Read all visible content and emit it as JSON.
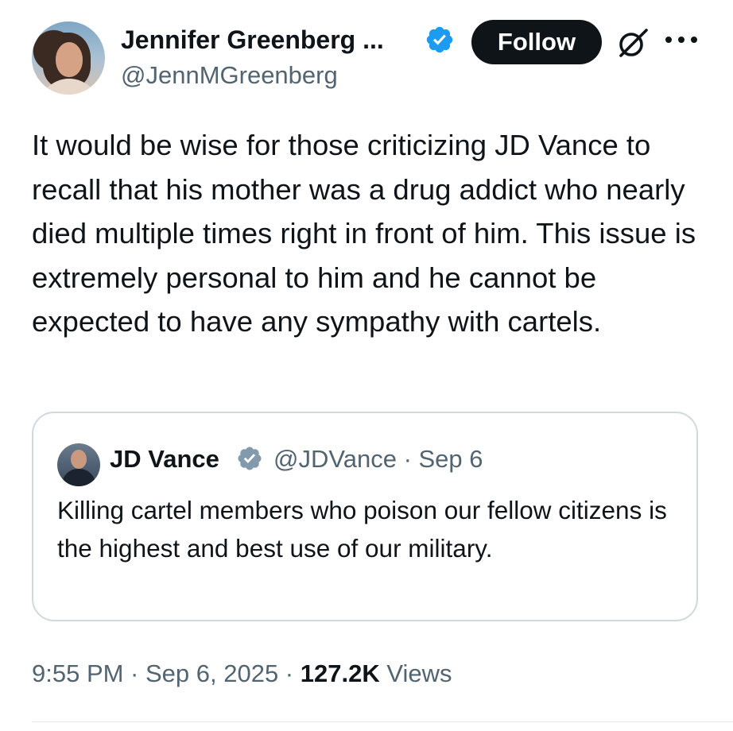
{
  "author": {
    "name": "Jennifer Greenberg ...",
    "handle": "@JennMGreenberg",
    "verified_color": "#1d9bf0"
  },
  "actions": {
    "follow_label": "Follow",
    "grok_icon": "grok-icon",
    "more_icon": "more-options-icon"
  },
  "tweet": {
    "text": "It would be wise for those criticizing JD Vance to recall that his mother was a drug addict who nearly died multiple times right in front of him. This issue is extremely personal to him and he cannot be expected to have any sympathy with cartels."
  },
  "quote": {
    "name": "JD Vance",
    "handle_date": "@JDVance · Sep 6",
    "verified_color": "#829aab",
    "text": "Killing cartel members who poison our fellow citizens is the highest and best use of our military."
  },
  "meta": {
    "time_date": "9:55 PM · Sep 6, 2025 · ",
    "views_count": "127.2K",
    "views_label": " Views"
  }
}
